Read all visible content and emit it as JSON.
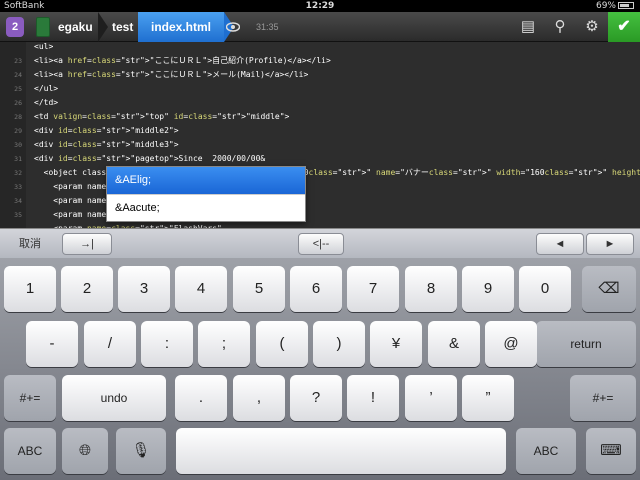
{
  "status": {
    "carrier": "SoftBank",
    "time": "12:29",
    "battery": "69%"
  },
  "toolbar": {
    "tab_count": "2",
    "crumbs": [
      "egaku",
      "test"
    ],
    "file": "index.html",
    "timestamp": "31:35",
    "icons": [
      "document-icon",
      "search-icon",
      "gear-icon",
      "check-icon"
    ]
  },
  "editor": {
    "lines": [
      {
        "n": "",
        "code": "<ul>"
      },
      {
        "n": "23",
        "code": "<li><a href=\"ここにＵＲＬ\">自己紹介(Profile)</a></li>"
      },
      {
        "n": "24",
        "code": "<li><a href=\"ここにＵＲＬ\">メール(Mail)</a></li>"
      },
      {
        "n": "25",
        "code": "</ul>"
      },
      {
        "n": "26",
        "code": "</td>"
      },
      {
        "n": "28",
        "code": "<td valign=\"top\" id=\"middle\">"
      },
      {
        "n": "29",
        "code": "<div id=\"middle2\">"
      },
      {
        "n": "30",
        "code": "<div id=\"middle3\">"
      },
      {
        "n": "31",
        "code": "<div id=\"pagetop\">Since  2000/00/00&"
      },
      {
        "n": "32",
        "code": "  <object class                                     40000\" name=\"バナー\" width=\"160\" height=\"65\" id=\"バナー\">"
      },
      {
        "n": "33",
        "code": "    <param name                              \">"
      },
      {
        "n": "34",
        "code": "    <param name"
      },
      {
        "n": "35",
        "code": "    <param name"
      },
      {
        "n": "",
        "code": "    <param name=\"FlashVars\""
      }
    ]
  },
  "autocomplete": {
    "items": [
      "&AElig;",
      "&Aacute;"
    ]
  },
  "accessory": {
    "cancel": "取消",
    "tab": "→|",
    "hide": "<|--",
    "prev": "◄",
    "next": "►"
  },
  "keyboard": {
    "row1": [
      "1",
      "2",
      "3",
      "4",
      "5",
      "6",
      "7",
      "8",
      "9",
      "0"
    ],
    "row2": [
      "-",
      "/",
      ":",
      ";",
      "(",
      ")",
      "¥",
      "&",
      "@"
    ],
    "return": "return",
    "row3_left": "#+=",
    "undo": "undo",
    "row3": [
      ".",
      ",",
      "?",
      "!",
      "’",
      "”"
    ],
    "row3_right": "#+=",
    "abc": "ABC",
    "abc_right": "ABC"
  }
}
